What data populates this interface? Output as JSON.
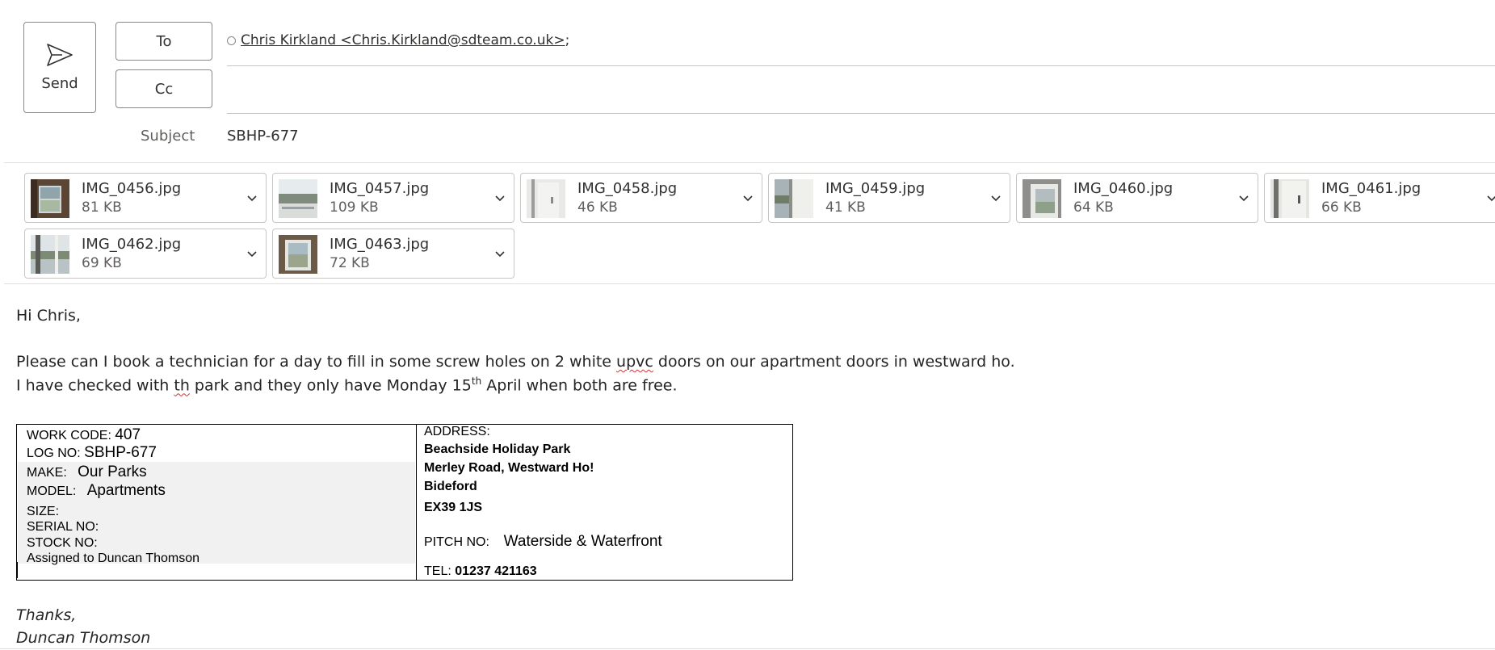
{
  "header": {
    "send_label": "Send",
    "to_label": "To",
    "cc_label": "Cc",
    "to_recipient": "Chris Kirkland <Chris.Kirkland@sdteam.co.uk>",
    "to_separator": ";",
    "cc_value": "",
    "subject_label": "Subject",
    "subject_value": "SBHP-677"
  },
  "attachments": [
    {
      "name": "IMG_0456.jpg",
      "size": "81 KB"
    },
    {
      "name": "IMG_0457.jpg",
      "size": "109 KB"
    },
    {
      "name": "IMG_0458.jpg",
      "size": "46 KB"
    },
    {
      "name": "IMG_0459.jpg",
      "size": "41 KB"
    },
    {
      "name": "IMG_0460.jpg",
      "size": "64 KB"
    },
    {
      "name": "IMG_0461.jpg",
      "size": "66 KB"
    },
    {
      "name": "IMG_0462.jpg",
      "size": "69 KB"
    },
    {
      "name": "IMG_0463.jpg",
      "size": "72 KB"
    }
  ],
  "body": {
    "greeting": "Hi Chris,",
    "line1": "Please can I book a technician for a day to fill in some screw holes on 2 white ",
    "line1_misspelt": "upvc",
    "line1_end": " doors on our apartment doors in westward ho.",
    "line2_start": "I have checked with ",
    "line2_misspelt": "th",
    "line2_mid": " park and they only have Monday 15",
    "line2_sup": "th",
    "line2_end": " April when both are free.",
    "signoff": "Thanks,",
    "signature": "Duncan Thomson"
  },
  "work_table": {
    "work_code_label": "WORK CODE:",
    "work_code": "407",
    "log_no_label": "LOG NO:",
    "log_no": "SBHP-677",
    "make_label": "MAKE:",
    "make": "Our Parks",
    "model_label": "MODEL:",
    "model": "Apartments",
    "size_label": "SIZE:",
    "serial_label": "SERIAL NO:",
    "stock_label": "STOCK NO:",
    "assigned": "Assigned to Duncan Thomson",
    "address_label": "ADDRESS:",
    "address_line1": "Beachside Holiday Park",
    "address_line2": "Merley Road, Westward Ho!",
    "address_line3": "Bideford",
    "postcode": "EX39 1JS",
    "pitch_label": "PITCH NO:",
    "pitch": "Waterside & Waterfront",
    "tel_label": "TEL:",
    "tel": "01237 421163"
  },
  "colors": {
    "misspelling_underline": "#d13438",
    "border": "#c8c6c4",
    "table_shade": "#f1f1f1"
  }
}
